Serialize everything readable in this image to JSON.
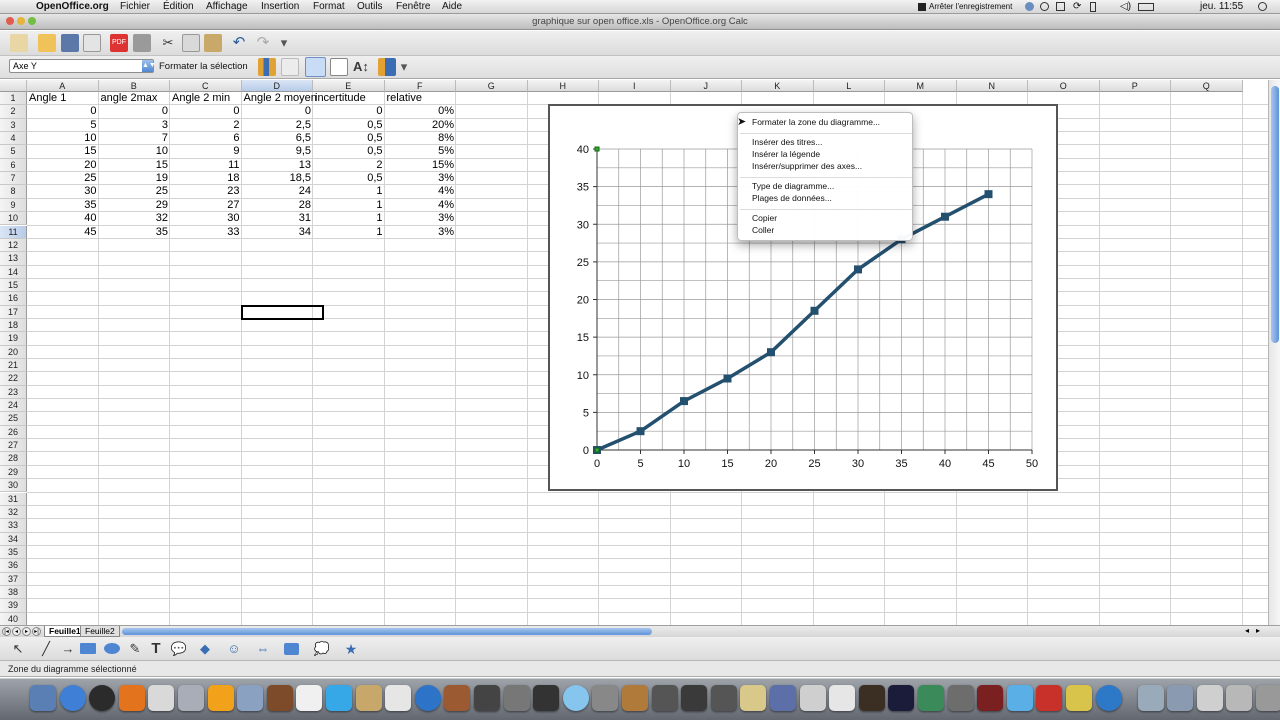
{
  "menubar": {
    "app": "OpenOffice.org",
    "items": [
      "Fichier",
      "Édition",
      "Affichage",
      "Insertion",
      "Format",
      "Outils",
      "Fenêtre",
      "Aide"
    ],
    "status_right": "Arrêter l'enregistrement",
    "clock": "jeu. 11:55"
  },
  "window": {
    "title": "graphique sur open office.xls - OpenOffice.org Calc"
  },
  "toolbar2": {
    "namebox": "Axe Y",
    "format_selection": "Formater la sélection"
  },
  "sheet": {
    "columns": [
      "A",
      "B",
      "C",
      "D",
      "E",
      "F",
      "G",
      "H",
      "I",
      "J",
      "K",
      "L",
      "M",
      "N",
      "O",
      "P",
      "Q"
    ],
    "rows": [
      "1",
      "2",
      "3",
      "4",
      "5",
      "6",
      "7",
      "8",
      "9",
      "10",
      "11",
      "12",
      "13",
      "14",
      "15",
      "16",
      "17",
      "18",
      "19",
      "20",
      "21",
      "22",
      "23",
      "24",
      "25",
      "26",
      "27",
      "28",
      "29",
      "30",
      "31",
      "32",
      "33",
      "34",
      "35",
      "36",
      "37",
      "38",
      "39",
      "40"
    ],
    "headers": [
      "Angle 1",
      "angle 2max",
      "Angle 2 min",
      "Angle 2 moyen",
      "incertitude",
      "relative"
    ],
    "data": [
      [
        "0",
        "0",
        "0",
        "0",
        "0",
        "0%"
      ],
      [
        "5",
        "3",
        "2",
        "2,5",
        "0,5",
        "20%"
      ],
      [
        "10",
        "7",
        "6",
        "6,5",
        "0,5",
        "8%"
      ],
      [
        "15",
        "10",
        "9",
        "9,5",
        "0,5",
        "5%"
      ],
      [
        "20",
        "15",
        "11",
        "13",
        "2",
        "15%"
      ],
      [
        "25",
        "19",
        "18",
        "18,5",
        "0,5",
        "3%"
      ],
      [
        "30",
        "25",
        "23",
        "24",
        "1",
        "4%"
      ],
      [
        "35",
        "29",
        "27",
        "28",
        "1",
        "4%"
      ],
      [
        "40",
        "32",
        "30",
        "31",
        "1",
        "3%"
      ],
      [
        "45",
        "35",
        "33",
        "34",
        "1",
        "3%"
      ]
    ],
    "tabs": [
      "Feuille1",
      "Feuille2"
    ]
  },
  "chart_data": {
    "type": "scatter",
    "x": [
      0,
      5,
      10,
      15,
      20,
      25,
      30,
      35,
      40,
      45
    ],
    "series": [
      {
        "values": [
          0,
          2.5,
          6.5,
          9.5,
          13,
          18.5,
          24,
          28,
          31,
          34
        ]
      }
    ],
    "xlim": [
      0,
      50
    ],
    "ylim": [
      0,
      40
    ],
    "xticks": [
      "0",
      "5",
      "10",
      "15",
      "20",
      "25",
      "30",
      "35",
      "40",
      "45",
      "50"
    ],
    "yticks": [
      "0",
      "5",
      "10",
      "15",
      "20",
      "25",
      "30",
      "35",
      "40"
    ],
    "grid": true,
    "line_color": "#24506f"
  },
  "context_menu": {
    "items": [
      [
        "Formater la zone du diagramme..."
      ],
      [
        "Insérer des titres...",
        "Insérer la légende",
        "Insérer/supprimer des axes..."
      ],
      [
        "Type de diagramme...",
        "Plages de données..."
      ],
      [
        "Copier",
        "Coller"
      ]
    ]
  },
  "status": {
    "text": "Zone du diagramme sélectionné"
  }
}
